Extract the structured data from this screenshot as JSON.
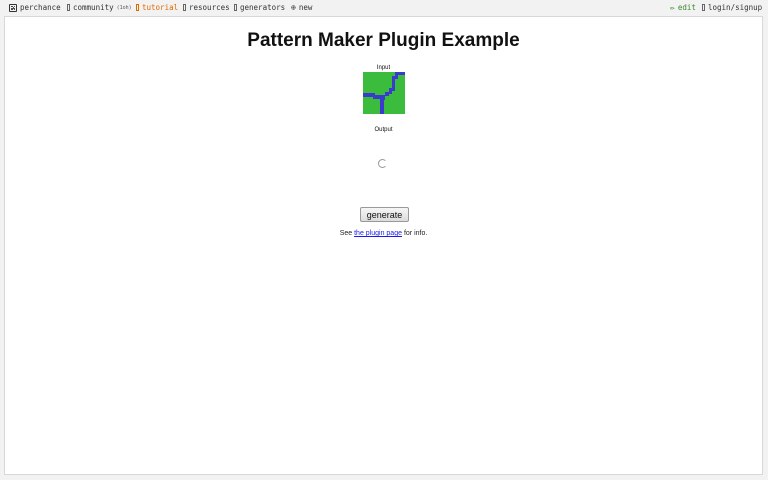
{
  "nav": {
    "logo_label": "perchance",
    "community_label": "community",
    "community_count": "(1oh)",
    "tutorial_label": "tutorial",
    "resources_label": "resources",
    "generators_label": "generators",
    "new_label": "new",
    "edit_label": "edit",
    "login_label": "login/signup"
  },
  "page": {
    "title": "Pattern Maker Plugin Example",
    "input_label": "Input",
    "output_label": "Output",
    "generate_label": "generate",
    "info_prefix": "See",
    "info_link": "the plugin page",
    "info_suffix": "for info."
  },
  "pattern": {
    "background_color": "#3cbc3c",
    "line_color": "#3a3ad0"
  }
}
